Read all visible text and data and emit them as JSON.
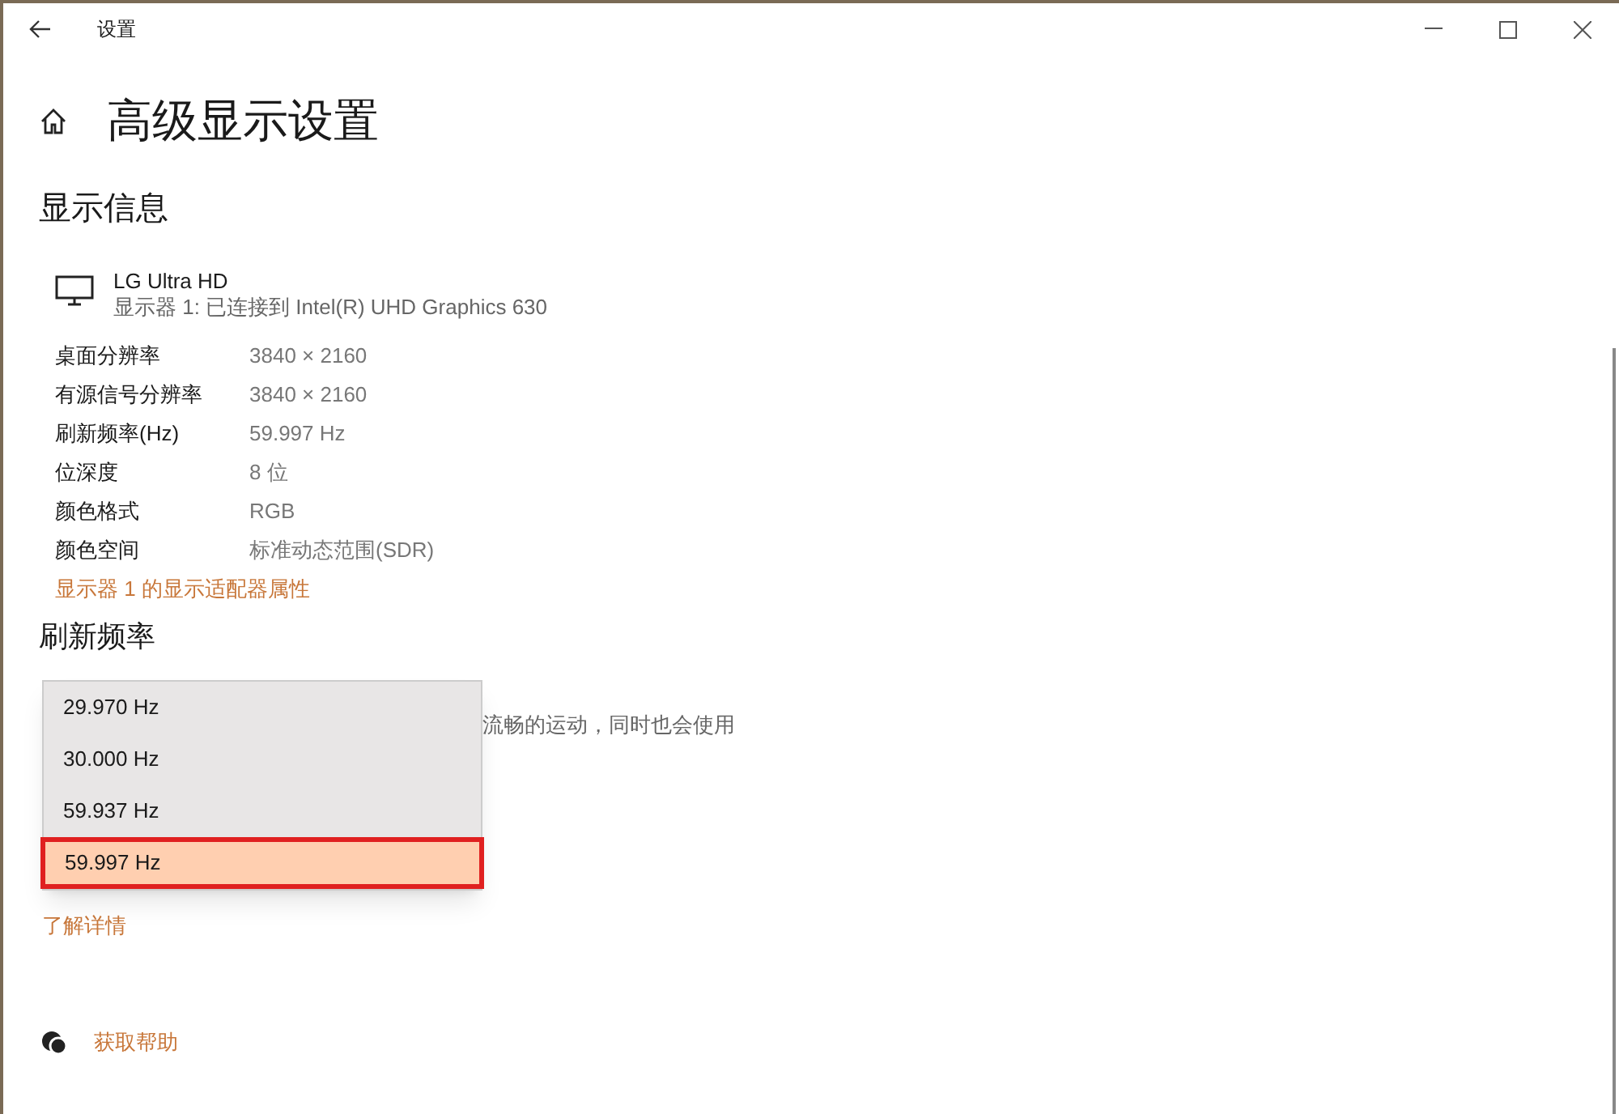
{
  "window": {
    "title": "设置"
  },
  "page_title": "高级显示设置",
  "display_info": {
    "heading": "显示信息",
    "monitor_name": "LG Ultra HD",
    "monitor_detail": "显示器 1: 已连接到 Intel(R) UHD Graphics 630",
    "rows": [
      {
        "label": "桌面分辨率",
        "value": "3840 × 2160"
      },
      {
        "label": "有源信号分辨率",
        "value": "3840 × 2160"
      },
      {
        "label": "刷新频率(Hz)",
        "value": "59.997 Hz"
      },
      {
        "label": "位深度",
        "value": "8 位"
      },
      {
        "label": "颜色格式",
        "value": "RGB"
      },
      {
        "label": "颜色空间",
        "value": "标准动态范围(SDR)"
      }
    ],
    "link": "显示器 1 的显示适配器属性"
  },
  "refresh_rate": {
    "heading": "刷新频率",
    "description": "流畅的运动，同时也会使用",
    "link": "了解详情",
    "options": [
      {
        "label": "29.970 Hz",
        "selected": false
      },
      {
        "label": "30.000 Hz",
        "selected": false
      },
      {
        "label": "59.937 Hz",
        "selected": false
      },
      {
        "label": "59.997 Hz",
        "selected": true
      }
    ]
  },
  "help_link": "获取帮助"
}
